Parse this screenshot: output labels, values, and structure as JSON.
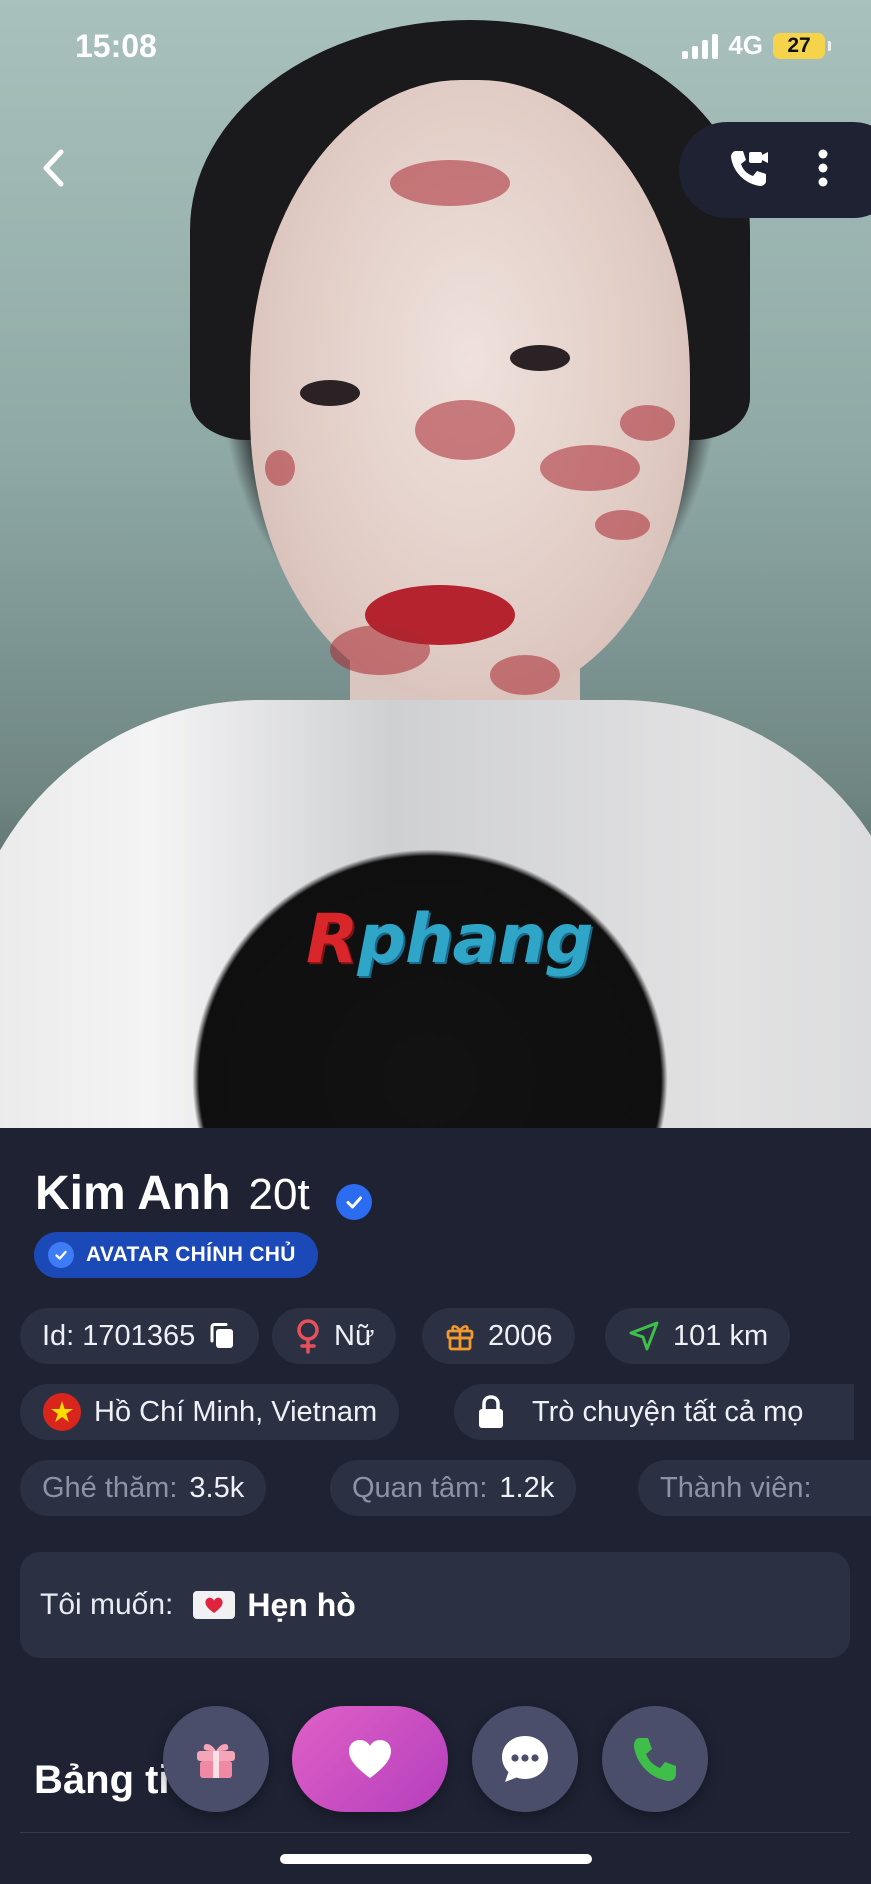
{
  "status_bar": {
    "time": "15:08",
    "network": "4G",
    "battery": "27"
  },
  "photo": {
    "watermark_prefix": "R",
    "watermark_rest": "phang"
  },
  "profile": {
    "name": "Kim Anh",
    "age": "20t",
    "badge": "AVATAR CHÍNH CHỦ",
    "id_label": "Id: 1701365",
    "gender": "Nữ",
    "birth_year": "2006",
    "distance": "101 km",
    "location": "Hồ Chí Minh, Vietnam",
    "privacy": "Trò chuyện tất cả mọ",
    "stats": [
      {
        "label": "Ghé thăm:",
        "value": "3.5k"
      },
      {
        "label": "Quan tâm:",
        "value": "1.2k"
      },
      {
        "label": "Thành viên:",
        "value": ""
      }
    ],
    "want_label": "Tôi muốn:",
    "want_value": "Hẹn hò",
    "section_title": "Bảng ti"
  },
  "colors": {
    "background": "#1e2233",
    "chip": "#2b3043",
    "accent_blue": "#2b6cf0",
    "heart_button": "#c94cc2",
    "call_green": "#3fbf4a",
    "gift_orange": "#f29a2e"
  },
  "icons": [
    "back-icon",
    "video-call-icon",
    "more-icon",
    "verified-icon",
    "copy-icon",
    "female-icon",
    "gift-icon",
    "location-arrow-icon",
    "vietnam-flag-icon",
    "lock-icon",
    "envelope-heart-icon",
    "heart-icon",
    "chat-icon",
    "phone-icon"
  ]
}
